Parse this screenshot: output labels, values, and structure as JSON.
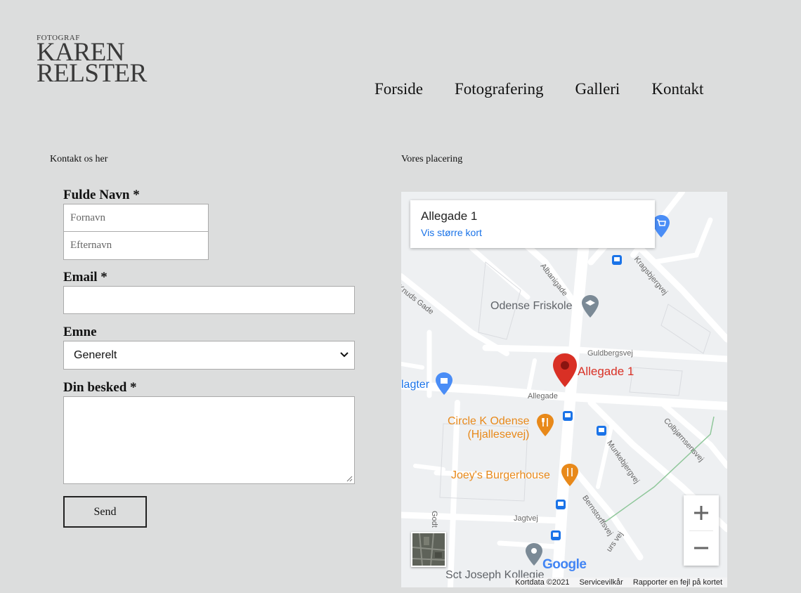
{
  "logo": {
    "small": "FOTOGRAF",
    "line1": "KAREN",
    "line2": "RELSTER"
  },
  "nav": [
    "Forside",
    "Fotografering",
    "Galleri",
    "Kontakt"
  ],
  "contact": {
    "heading": "Kontakt os her",
    "name_label": "Fulde Navn *",
    "firstname_placeholder": "Fornavn",
    "lastname_placeholder": "Efternavn",
    "email_label": "Email *",
    "email_value": "",
    "subject_label": "Emne",
    "subject_value": "Generelt",
    "message_label": "Din besked *",
    "message_value": "",
    "send_label": "Send"
  },
  "location": {
    "heading": "Vores placering",
    "card_title": "Allegade 1",
    "card_link": "Vis større kort",
    "pin_label": "Allegade 1",
    "places": {
      "school": "Odense Friskole",
      "circle_k_1": "Circle K Odense",
      "circle_k_2": "(Hjallesevej)",
      "burger": "Joey's Burgerhouse",
      "lagter": "lagter",
      "kollegie": "Sct Joseph Kollegie"
    },
    "streets": {
      "albanigade": "Albanigade",
      "kragsbjergvej": "Kragsbjergvej",
      "knuds_gade": "Knuds Gade",
      "guldbergsvej": "Guldbergsvej",
      "allegade": "Allegade",
      "munkebjergvej": "Munkebjergvej",
      "colbjornsensvej": "Colbjørnsensvej",
      "bernstorffsvej": "Bernstorffsvej",
      "jagtvej": "Jagtvej",
      "godt": "Godt",
      "urs_vej": "urs vej"
    },
    "google": "Google",
    "footer": [
      "Kortdata ©2021",
      "Servicevilkår",
      "Rapporter en fejl på kortet"
    ],
    "colors": {
      "pin": "#d93025",
      "food": "#e8891a",
      "link": "#1a73e8",
      "shop": "#4a8df6",
      "transit": "#1a73e8"
    }
  }
}
